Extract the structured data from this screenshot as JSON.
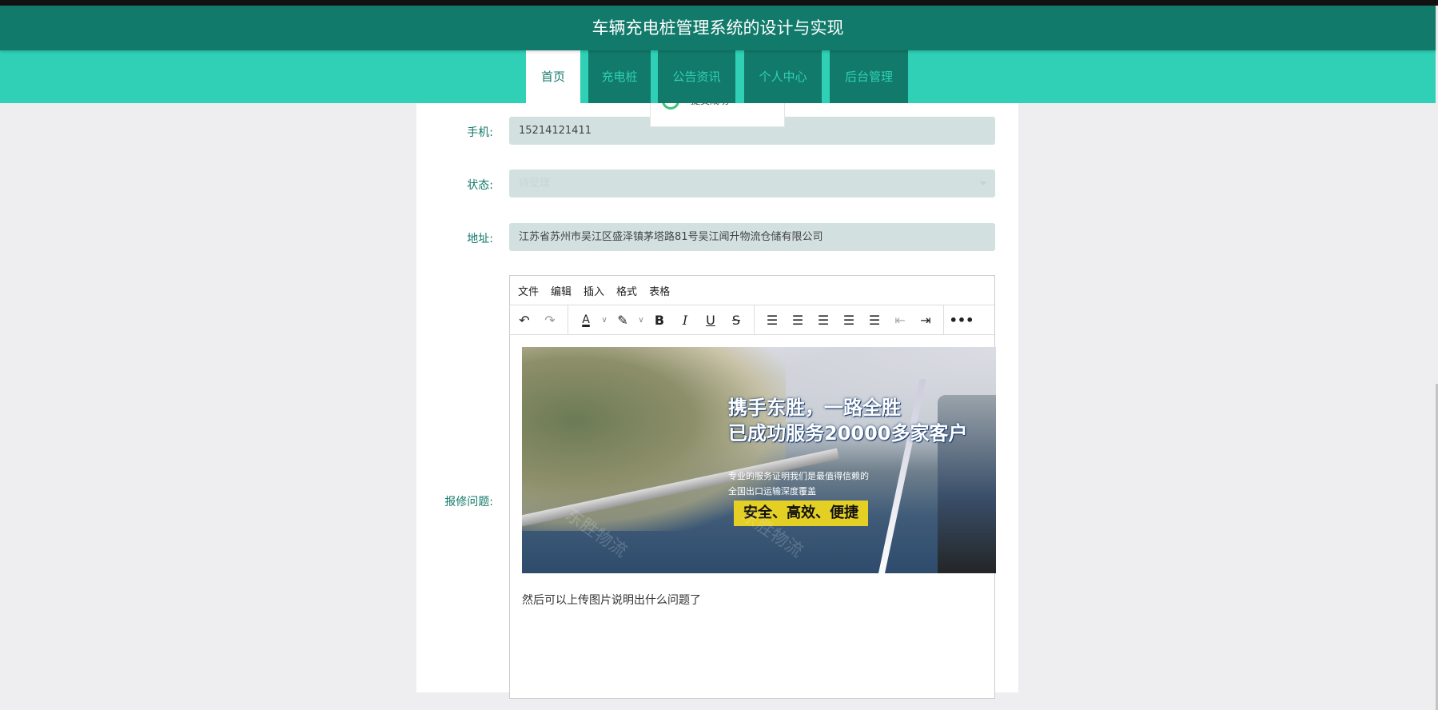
{
  "header": {
    "title": "车辆充电桩管理系统的设计与实现"
  },
  "nav": [
    {
      "label": "首页",
      "active": true
    },
    {
      "label": "充电桩"
    },
    {
      "label": "公告资讯"
    },
    {
      "label": "个人中心"
    },
    {
      "label": "后台管理"
    }
  ],
  "toast": {
    "text": "提交成功"
  },
  "form": {
    "phone": {
      "label": "手机:",
      "value": "15214121411"
    },
    "status": {
      "label": "状态:",
      "value": "待受理"
    },
    "address": {
      "label": "地址:",
      "value": "江苏省苏州市吴江区盛泽镇茅塔路81号吴江闻升物流仓储有限公司"
    },
    "problem": {
      "label": "报修问题:"
    }
  },
  "editor": {
    "menu": [
      "文件",
      "编辑",
      "插入",
      "格式",
      "表格"
    ],
    "image": {
      "headline1": "携手东胜，一路全胜",
      "headline2": "已成功服务20000多家客户",
      "sub1": "专业的服务证明我们是最值得信赖的",
      "sub2": "全国出口运输深度覆盖",
      "badge": "安全、高效、便捷",
      "watermark": "东胜物流"
    },
    "text": "然后可以上传图片说明出什么问题了"
  },
  "colors": {
    "primary": "#127a6a",
    "accent": "#2fd0b5",
    "input_bg": "#d2e1e0"
  }
}
